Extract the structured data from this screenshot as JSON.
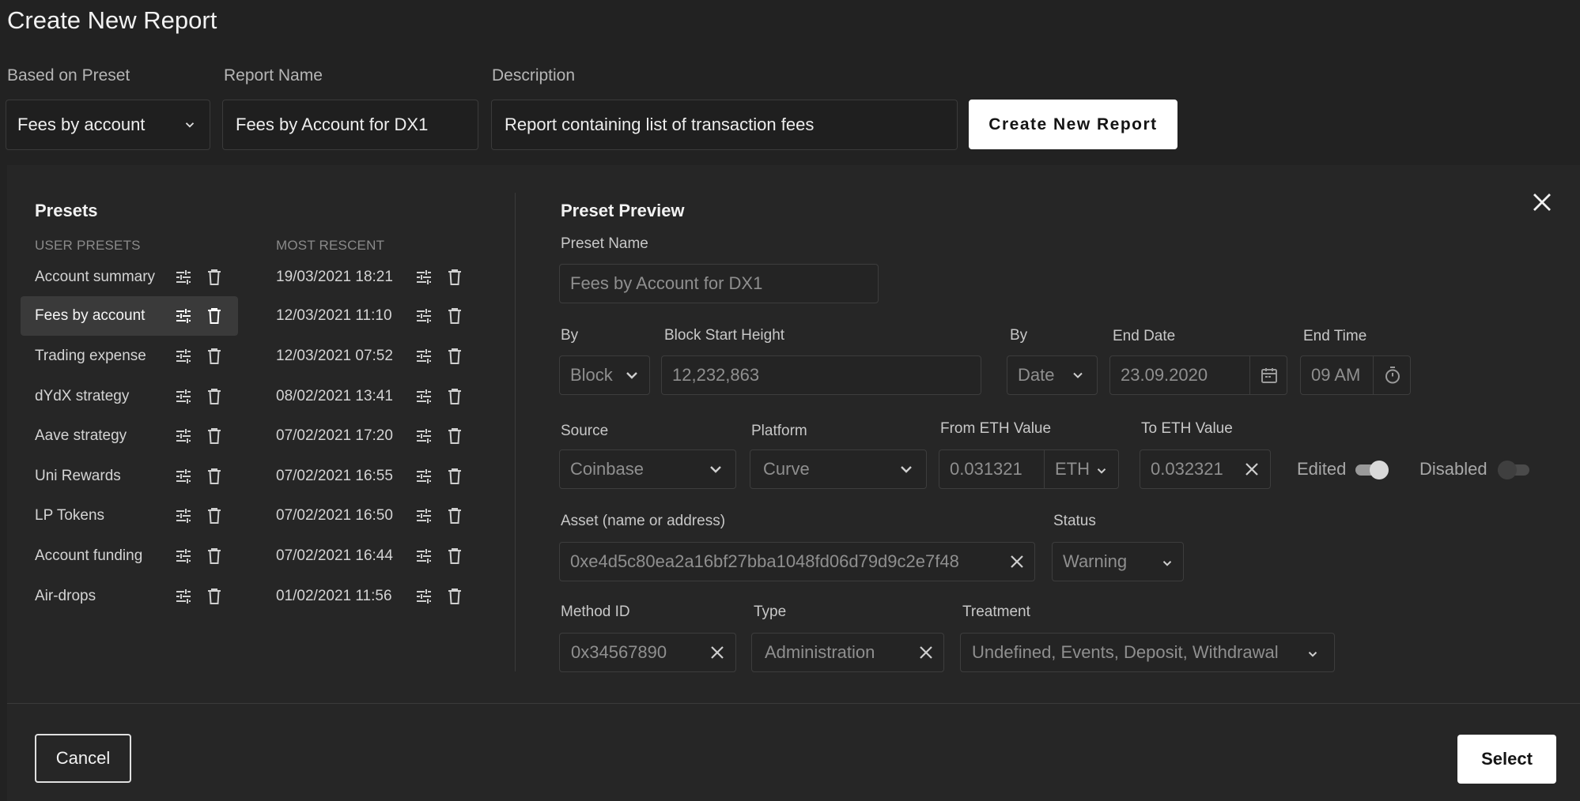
{
  "page_title": "Create New Report",
  "top_form": {
    "preset_label": "Based on Preset",
    "preset_value": "Fees by account",
    "name_label": "Report Name",
    "name_value": "Fees by Account for DX1",
    "description_label": "Description",
    "description_value": "Report containing list of transaction fees",
    "create_button": "Create New Report"
  },
  "presets": {
    "title": "Presets",
    "user_header": "USER PRESETS",
    "recent_header": "MOST RESCENT",
    "user_items": [
      {
        "label": "Account summary"
      },
      {
        "label": "Fees by account",
        "selected": true
      },
      {
        "label": "Trading expense"
      },
      {
        "label": "dYdX strategy"
      },
      {
        "label": "Aave strategy"
      },
      {
        "label": "Uni Rewards"
      },
      {
        "label": "LP Tokens"
      },
      {
        "label": "Account funding"
      },
      {
        "label": "Air-drops"
      }
    ],
    "recent_items": [
      {
        "label": "19/03/2021 18:21"
      },
      {
        "label": "12/03/2021 11:10"
      },
      {
        "label": "12/03/2021 07:52"
      },
      {
        "label": "08/02/2021 13:41"
      },
      {
        "label": "07/02/2021 17:20"
      },
      {
        "label": "07/02/2021 16:55"
      },
      {
        "label": "07/02/2021 16:50"
      },
      {
        "label": "07/02/2021 16:44"
      },
      {
        "label": "01/02/2021 11:56"
      }
    ]
  },
  "preview": {
    "title": "Preset Preview",
    "preset_name_label": "Preset Name",
    "preset_name_value": "Fees by Account for DX1",
    "by_label_1": "By",
    "by_value_1": "Block",
    "block_start_label": "Block Start Height",
    "block_start_value": "12,232,863",
    "by_label_2": "By",
    "by_value_2": "Date",
    "end_date_label": "End Date",
    "end_date_value": "23.09.2020",
    "end_time_label": "End Time",
    "end_time_value": "09 AM",
    "source_label": "Source",
    "source_value": "Coinbase",
    "platform_label": "Platform",
    "platform_value": "Curve",
    "from_eth_label": "From ETH Value",
    "from_eth_value": "0.031321",
    "from_eth_unit": "ETH",
    "to_eth_label": "To ETH Value",
    "to_eth_value": "0.032321",
    "edited_label": "Edited",
    "edited_on": true,
    "disabled_label": "Disabled",
    "disabled_on": false,
    "asset_label": "Asset (name or address)",
    "asset_value": "0xe4d5c80ea2a16bf27bba1048fd06d79d9c2e7f48",
    "status_label": "Status",
    "status_value": "Warning",
    "method_label": "Method ID",
    "method_value": "0x34567890",
    "type_label": "Type",
    "type_value": "Administration",
    "treatment_label": "Treatment",
    "treatment_value": "Undefined, Events, Deposit, Withdrawal"
  },
  "footer": {
    "cancel": "Cancel",
    "select": "Select"
  },
  "icons": {
    "adjust": "tune-icon",
    "delete": "trash-icon",
    "close": "close-icon",
    "calendar": "calendar-icon",
    "timer": "timer-icon",
    "dropdown": "chevron-down-icon",
    "clear": "clear-icon"
  },
  "colors": {
    "background": "#222222",
    "panel": "#262626",
    "selected_row": "#3a3a3a",
    "button_primary": "#ffffff"
  }
}
